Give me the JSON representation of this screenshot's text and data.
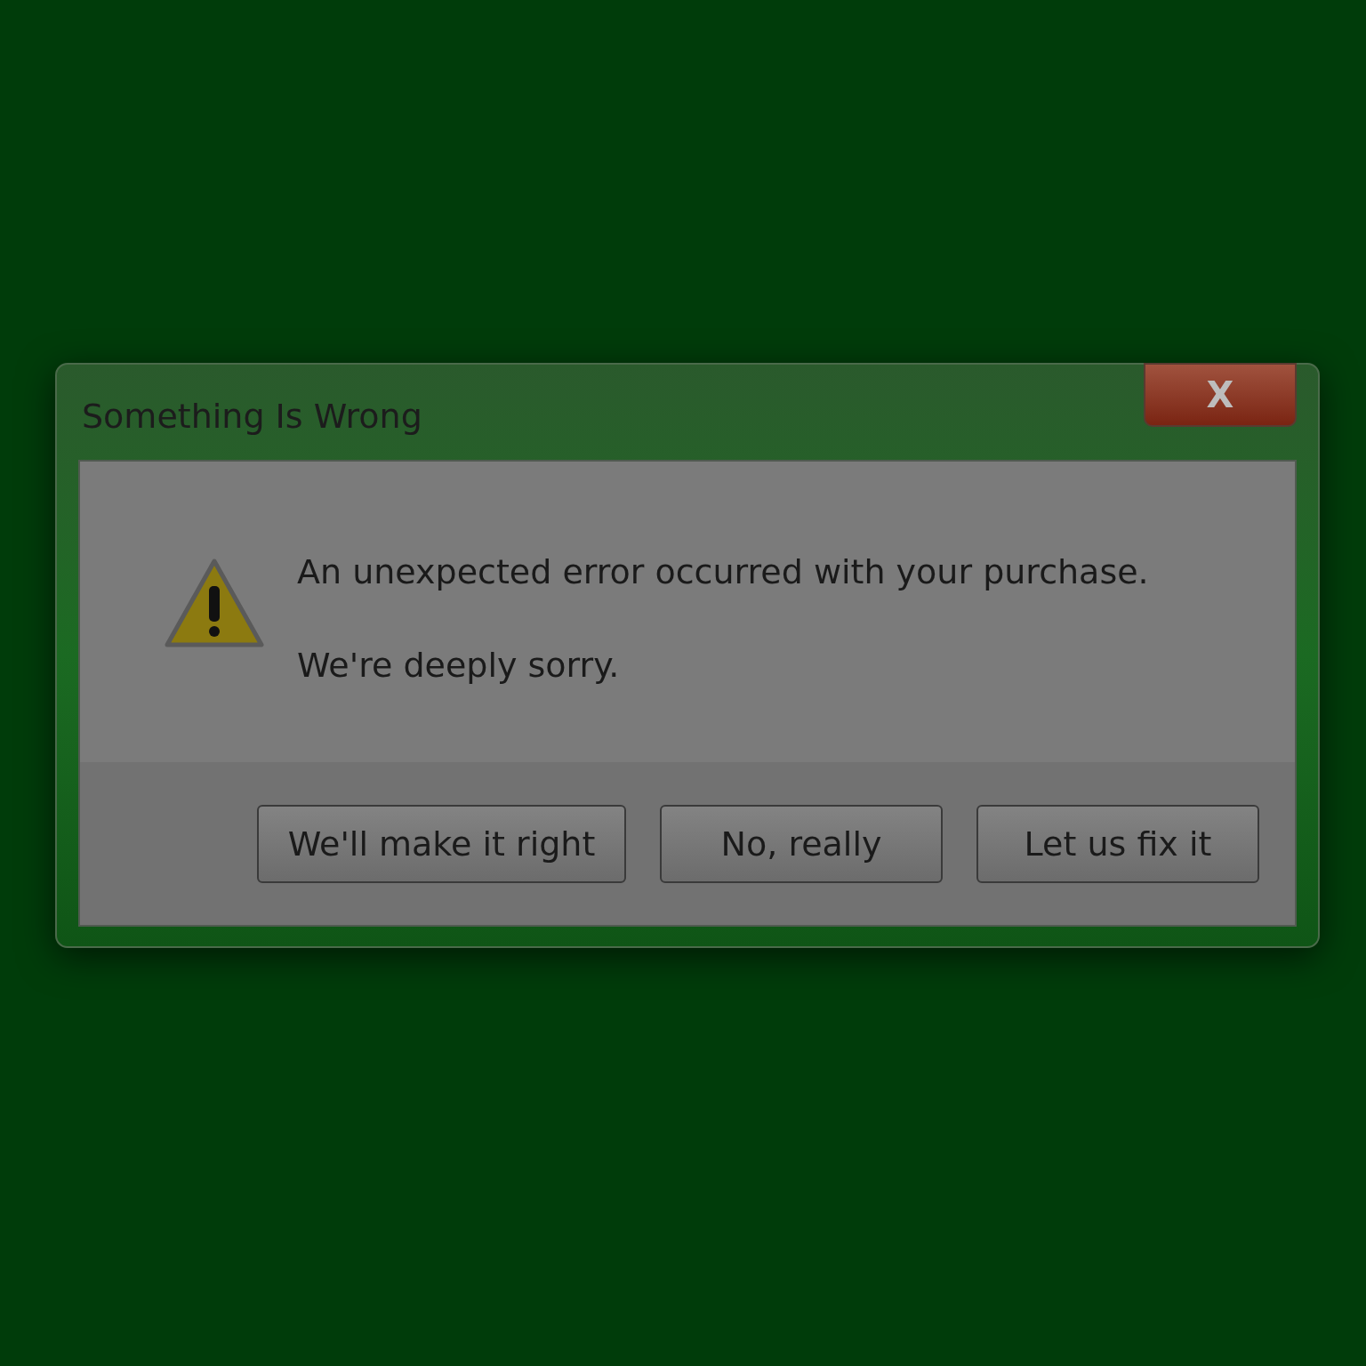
{
  "window": {
    "title": "Something Is Wrong",
    "close": "X"
  },
  "messages": [
    "An unexpected error occurred with your purchase.",
    "We're deeply sorry."
  ],
  "buttons": [
    "We'll make it right",
    "No, really",
    "Let us fix it"
  ]
}
